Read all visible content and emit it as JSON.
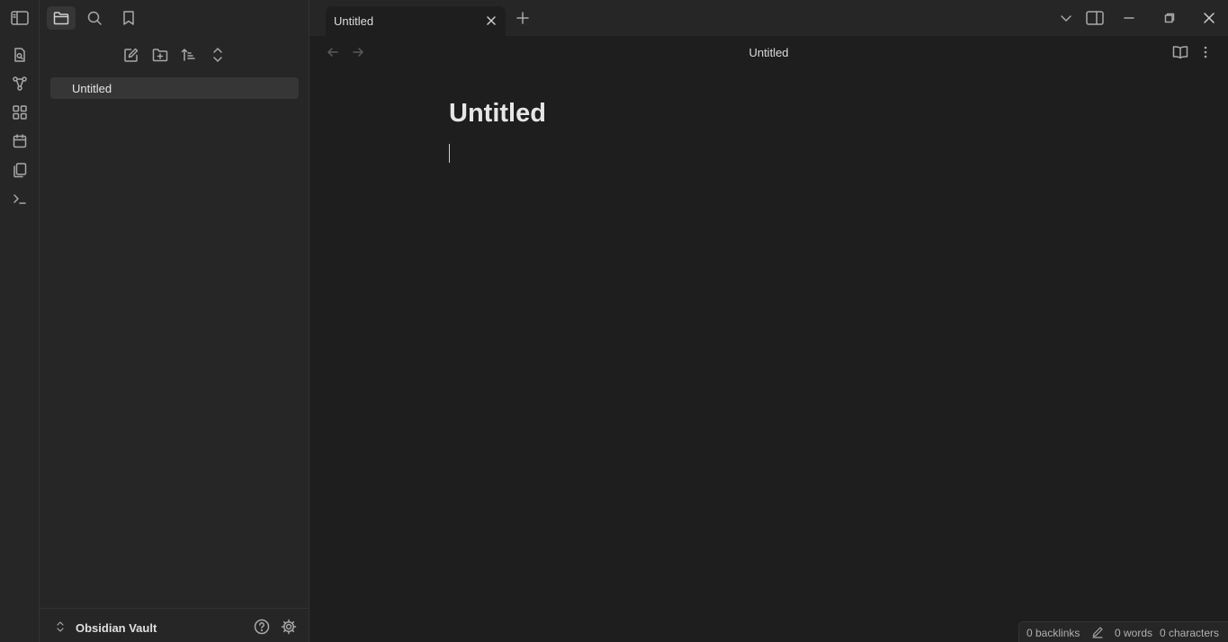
{
  "tab": {
    "title": "Untitled"
  },
  "view": {
    "title": "Untitled"
  },
  "explorer": {
    "files": [
      "Untitled"
    ]
  },
  "vault": {
    "name": "Obsidian Vault"
  },
  "note": {
    "title": "Untitled"
  },
  "status": {
    "backlinks": "0 backlinks",
    "words": "0 words",
    "characters": "0 characters"
  },
  "icons": {
    "ribbon": [
      "open-quick-switcher-icon",
      "graph-view-icon",
      "canvas-icon",
      "daily-note-icon",
      "templates-icon",
      "command-palette-icon"
    ],
    "sidebar_top": [
      "sidebar-toggle-icon",
      "folder-icon",
      "search-icon",
      "bookmark-icon"
    ],
    "explorer_nav": [
      "new-note-icon",
      "new-folder-icon",
      "sort-icon",
      "collapse-icon"
    ]
  },
  "colors": {
    "background": "#1e1e1e",
    "panel": "#262626",
    "selected": "#363636"
  }
}
